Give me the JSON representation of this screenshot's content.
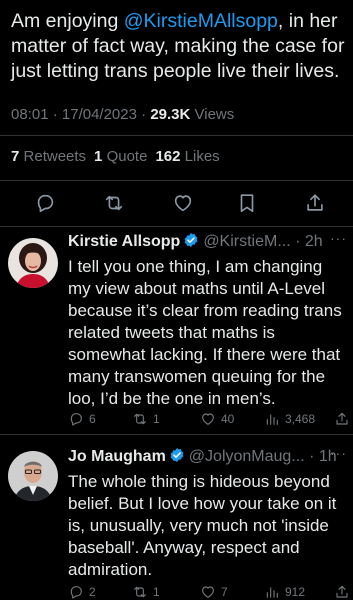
{
  "main_tweet": {
    "text_before": "Am enjoying ",
    "mention": "@KirstieMAllsopp",
    "text_after": ", in her matter of fact way, making the case for just letting trans people live their lives.",
    "time": "08:01",
    "date": "17/04/2023",
    "views_count": "29.3K",
    "views_label": "Views",
    "retweets_count": "7",
    "retweets_label": "Retweets",
    "quotes_count": "1",
    "quotes_label": "Quote",
    "likes_count": "162",
    "likes_label": "Likes"
  },
  "action_icons": [
    "reply-icon",
    "retweet-icon",
    "like-icon",
    "bookmark-icon",
    "share-icon"
  ],
  "replies": [
    {
      "name": "Kirstie Allsopp",
      "handle": "@KirstieM...",
      "time": "2h",
      "more": "···",
      "text": "I tell you one thing, I am changing my view about maths until A-Level because it’s clear from reading trans related tweets that maths is somewhat lacking. If there were that many transwomen queuing for the loo, I’d be the one in men’s.",
      "replies": "6",
      "retweets": "1",
      "likes": "40",
      "views": "3,468"
    },
    {
      "name": "Jo Maugham",
      "handle": "@JolyonMaug...",
      "time": "1h",
      "more": "···",
      "text": "The whole thing is hideous beyond belief. But I love how your take on it is, unusually, very much not 'inside baseball'. Anyway, respect and admiration.",
      "replies": "2",
      "retweets": "1",
      "likes": "7",
      "views": "912"
    }
  ],
  "colors": {
    "background": "#000000",
    "text": "#e7e9ea",
    "muted": "#71767b",
    "link": "#1d9bf0",
    "divider": "#2f3336"
  }
}
